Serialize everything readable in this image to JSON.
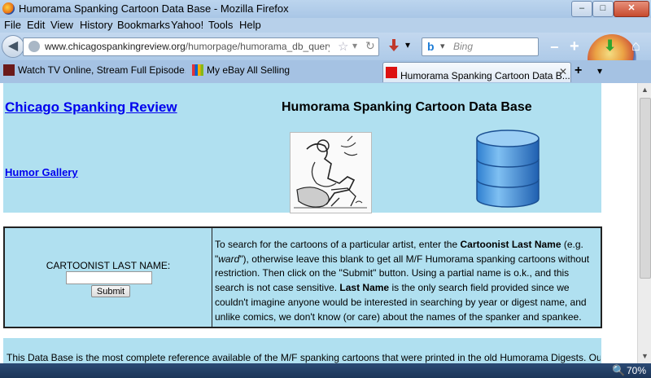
{
  "window": {
    "title": "Humorama Spanking Cartoon Data Base - Mozilla Firefox",
    "minimize": "–",
    "maximize": "□",
    "close": "✕"
  },
  "menu": [
    "File",
    "Edit",
    "View",
    "History",
    "Bookmarks",
    "Yahoo!",
    "Tools",
    "Help"
  ],
  "navbar": {
    "url_host": "www.chicagospankingreview.org",
    "url_path": "/humorpage/humorama_db_query.htm",
    "search_placeholder": "Bing",
    "search_engine_glyph": "b"
  },
  "tabs": [
    {
      "label": "Watch TV Online, Stream Full Episode...",
      "active": false
    },
    {
      "label": "My eBay All Selling",
      "active": false
    },
    {
      "label": "Humorama Spanking Cartoon Data B...",
      "active": true
    }
  ],
  "page": {
    "site_link": "Chicago Spanking Review",
    "page_title": "Humorama Spanking Cartoon Data Base",
    "gallery_link": "Humor Gallery",
    "form": {
      "label": "CARTOONIST LAST NAME:",
      "submit_label": "Submit",
      "instructions": [
        {
          "t": "To search for the cartoons of a particular artist, enter the "
        },
        {
          "t": "Cartoonist Last Name",
          "b": true
        },
        {
          "t": " (e.g. \""
        },
        {
          "t": "ward",
          "i": true
        },
        {
          "t": "\"), otherwise leave this blank to get all M/F Humorama spanking cartoons without restriction. Then click on the \"Submit\" button. Using a partial name is o.k., and this search is not case sensitive. "
        },
        {
          "t": "Last Name",
          "b": true
        },
        {
          "t": " is the only search field provided since we couldn't imagine anyone would be interested in searching by year or digest name, and unlike comics, we don't know (or care) about the names of the spanker and spankee."
        }
      ]
    },
    "intro_text": "This Data Base is the most complete reference available of the M/F spanking cartoons that were printed in the old Humorama Digests. Our"
  },
  "status": {
    "zoom": "70%"
  },
  "colors": {
    "page_bg": "#b0e0f0",
    "link": "#0000ee",
    "titlebar": "#bcd5ee",
    "statusbar": "#1c3558"
  }
}
